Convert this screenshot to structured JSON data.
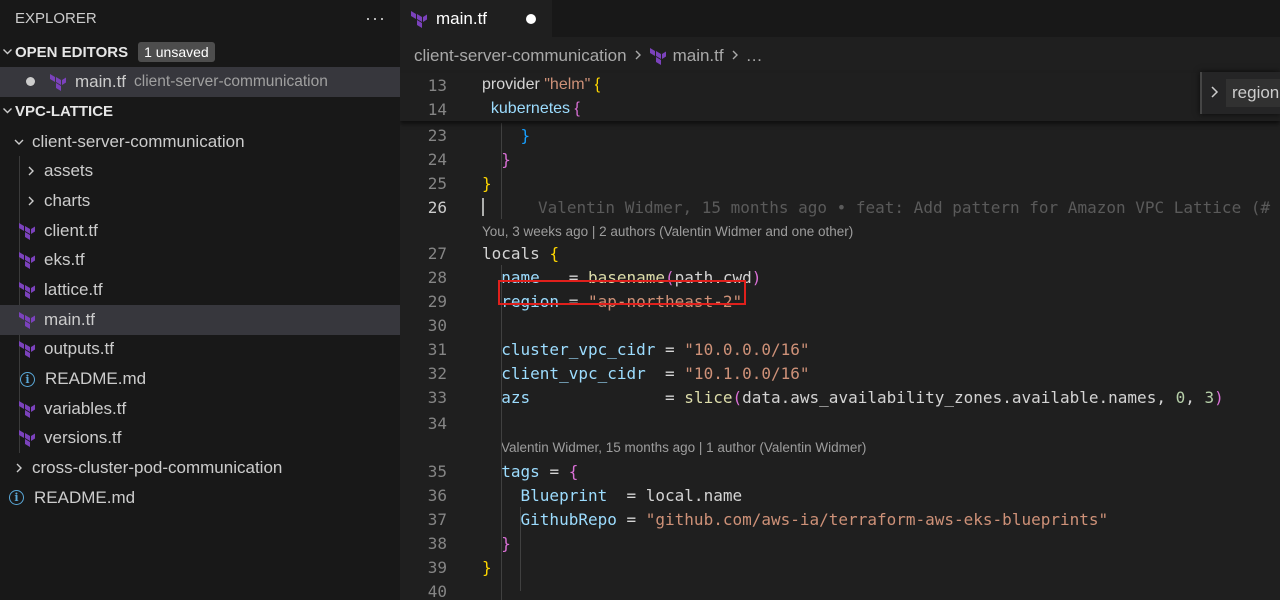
{
  "sidebar": {
    "title": "EXPLORER",
    "more": "···",
    "open_editors": {
      "title": "OPEN EDITORS",
      "badge": "1 unsaved",
      "items": [
        {
          "name": "main.tf",
          "desc": "client-server-communication"
        }
      ]
    },
    "workspace": {
      "title": "VPC-LATTICE",
      "folder": "client-server-communication",
      "children": [
        {
          "label": "assets",
          "kind": "folder"
        },
        {
          "label": "charts",
          "kind": "folder"
        },
        {
          "label": "client.tf",
          "kind": "tf"
        },
        {
          "label": "eks.tf",
          "kind": "tf"
        },
        {
          "label": "lattice.tf",
          "kind": "tf"
        },
        {
          "label": "main.tf",
          "kind": "tf"
        },
        {
          "label": "outputs.tf",
          "kind": "tf"
        },
        {
          "label": "README.md",
          "kind": "info"
        },
        {
          "label": "variables.tf",
          "kind": "tf"
        },
        {
          "label": "versions.tf",
          "kind": "tf"
        }
      ],
      "sibling_folder": "cross-cluster-pod-communication",
      "root_readme": "README.md"
    }
  },
  "editor": {
    "tab": {
      "label": "main.tf",
      "modified": true
    },
    "breadcrumb": {
      "folder": "client-server-communication",
      "file": "main.tf",
      "more": "…"
    },
    "find": {
      "value": "region",
      "toggle": "›"
    },
    "sticky": [
      {
        "num": "13",
        "parts": [
          [
            "provider ",
            "ct"
          ],
          [
            "\"helm\"",
            "str"
          ],
          [
            " ",
            "ct"
          ],
          [
            "{",
            "b1"
          ]
        ]
      },
      {
        "num": "14",
        "parts": [
          [
            "  kubernetes ",
            "kw"
          ],
          [
            "{",
            "b2"
          ]
        ]
      }
    ],
    "lines": [
      {
        "num": "23",
        "parts": [
          [
            "    ",
            "ct"
          ],
          [
            "}",
            "b3"
          ]
        ]
      },
      {
        "num": "24",
        "parts": [
          [
            "  ",
            "ct"
          ],
          [
            "}",
            "b2"
          ]
        ]
      },
      {
        "num": "25",
        "parts": [
          [
            "}",
            "b1"
          ]
        ]
      },
      {
        "num": "26",
        "parts": [],
        "current": true,
        "blame": "Valentin Widmer, 15 months ago • feat: Add pattern for Amazon VPC Lattice (#"
      },
      {
        "lens": "You, 3 weeks ago | 2 authors (Valentin Widmer and one other)"
      },
      {
        "num": "27",
        "parts": [
          [
            "locals ",
            "ct"
          ],
          [
            "{",
            "b1"
          ]
        ]
      },
      {
        "num": "28",
        "parts": [
          [
            "  name   ",
            "kw"
          ],
          [
            "= ",
            "ct"
          ],
          [
            "basename",
            "fn"
          ],
          [
            "(",
            "b2"
          ],
          [
            "path.cwd",
            "ct"
          ],
          [
            ")",
            "b2"
          ]
        ]
      },
      {
        "num": "29",
        "parts": [
          [
            "  region",
            "kw"
          ],
          [
            " = ",
            "ct"
          ],
          [
            "\"ap-northeast-2\"",
            "str"
          ]
        ]
      },
      {
        "num": "30",
        "parts": []
      },
      {
        "num": "31",
        "parts": [
          [
            "  cluster_vpc_cidr ",
            "kw"
          ],
          [
            "= ",
            "ct"
          ],
          [
            "\"10.0.0.0/16\"",
            "str"
          ]
        ]
      },
      {
        "num": "32",
        "parts": [
          [
            "  client_vpc_cidr  ",
            "kw"
          ],
          [
            "= ",
            "ct"
          ],
          [
            "\"10.1.0.0/16\"",
            "str"
          ]
        ]
      },
      {
        "num": "33",
        "parts": [
          [
            "  azs              ",
            "kw"
          ],
          [
            "= ",
            "ct"
          ],
          [
            "slice",
            "fn"
          ],
          [
            "(",
            "b2"
          ],
          [
            "data.aws_availability_zones.available.names, ",
            "ct"
          ],
          [
            "0",
            "num"
          ],
          [
            ", ",
            "ct"
          ],
          [
            "3",
            "num"
          ],
          [
            ")",
            "b2"
          ]
        ]
      },
      {
        "num": "34",
        "parts": []
      },
      {
        "lens": "Valentin Widmer, 15 months ago | 1 author (Valentin Widmer)",
        "indent": true
      },
      {
        "num": "35",
        "parts": [
          [
            "  tags ",
            "kw"
          ],
          [
            "= ",
            "ct"
          ],
          [
            "{",
            "b2"
          ]
        ]
      },
      {
        "num": "36",
        "parts": [
          [
            "    Blueprint  ",
            "kw"
          ],
          [
            "= ",
            "ct"
          ],
          [
            "local.name",
            "ct"
          ]
        ]
      },
      {
        "num": "37",
        "parts": [
          [
            "    GithubRepo ",
            "kw"
          ],
          [
            "= ",
            "ct"
          ],
          [
            "\"github.com/aws-ia/terraform-aws-eks-blueprints\"",
            "str"
          ]
        ]
      },
      {
        "num": "38",
        "parts": [
          [
            "  ",
            "ct"
          ],
          [
            "}",
            "b2"
          ]
        ]
      },
      {
        "num": "39",
        "parts": [
          [
            "}",
            "b1"
          ]
        ]
      },
      {
        "num": "40",
        "parts": []
      }
    ]
  },
  "colors": {
    "highlight_box": "#e0201c",
    "terraform_purple": "#7b42bc"
  }
}
